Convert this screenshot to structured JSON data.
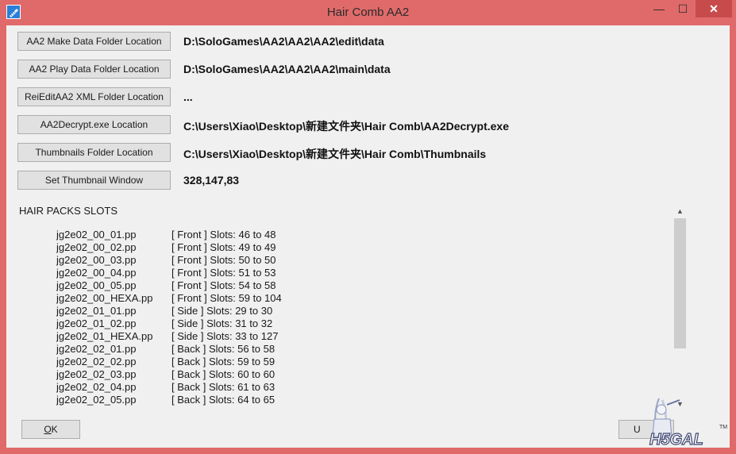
{
  "window": {
    "title": "Hair Comb AA2"
  },
  "titlebar": {
    "min": "—",
    "max": "☐",
    "close": "✕"
  },
  "rows": [
    {
      "button": "AA2 Make Data Folder Location",
      "value": "D:\\SoloGames\\AA2\\AA2\\AA2\\edit\\data"
    },
    {
      "button": "AA2 Play Data Folder Location",
      "value": "D:\\SoloGames\\AA2\\AA2\\AA2\\main\\data"
    },
    {
      "button": "ReiEditAA2 XML Folder Location",
      "value": "..."
    },
    {
      "button": "AA2Decrypt.exe Location",
      "value": "C:\\Users\\Xiao\\Desktop\\新建文件夹\\Hair Comb\\AA2Decrypt.exe"
    },
    {
      "button": "Thumbnails Folder Location",
      "value": "C:\\Users\\Xiao\\Desktop\\新建文件夹\\Hair Comb\\Thumbnails"
    },
    {
      "button": "Set Thumbnail Window",
      "value": "328,147,83"
    }
  ],
  "hair_packs": {
    "label": "HAIR PACKS SLOTS",
    "items": [
      {
        "file": "jg2e02_00_01.pp",
        "info": "[ Front ]  Slots: 46 to 48"
      },
      {
        "file": "jg2e02_00_02.pp",
        "info": "[ Front ]  Slots: 49 to 49"
      },
      {
        "file": "jg2e02_00_03.pp",
        "info": "[ Front ]  Slots: 50 to 50"
      },
      {
        "file": "jg2e02_00_04.pp",
        "info": "[ Front ]  Slots: 51 to 53"
      },
      {
        "file": "jg2e02_00_05.pp",
        "info": "[ Front ]  Slots: 54 to 58"
      },
      {
        "file": "jg2e02_00_HEXA.pp",
        "info": "[ Front ]  Slots: 59 to 104"
      },
      {
        "file": "jg2e02_01_01.pp",
        "info": "[ Side ]  Slots: 29 to 30"
      },
      {
        "file": "jg2e02_01_02.pp",
        "info": "[ Side ]  Slots: 31 to 32"
      },
      {
        "file": "jg2e02_01_HEXA.pp",
        "info": "[ Side ]  Slots: 33 to 127"
      },
      {
        "file": "jg2e02_02_01.pp",
        "info": "[ Back ]  Slots: 56 to 58"
      },
      {
        "file": "jg2e02_02_02.pp",
        "info": "[ Back ]  Slots: 59 to 59"
      },
      {
        "file": "jg2e02_02_03.pp",
        "info": "[ Back ]  Slots: 60 to 60"
      },
      {
        "file": "jg2e02_02_04.pp",
        "info": "[ Back ]  Slots: 61 to 63"
      },
      {
        "file": "jg2e02_02_05.pp",
        "info": "[ Back ]  Slots: 64 to 65"
      }
    ]
  },
  "footer": {
    "ok_underlined": "O",
    "ok_rest": "K",
    "right_button": "U"
  },
  "scrollbar": {
    "up": "▲",
    "down": "▼"
  },
  "logo": {
    "text": "H5GAL",
    "tm": "TM"
  }
}
